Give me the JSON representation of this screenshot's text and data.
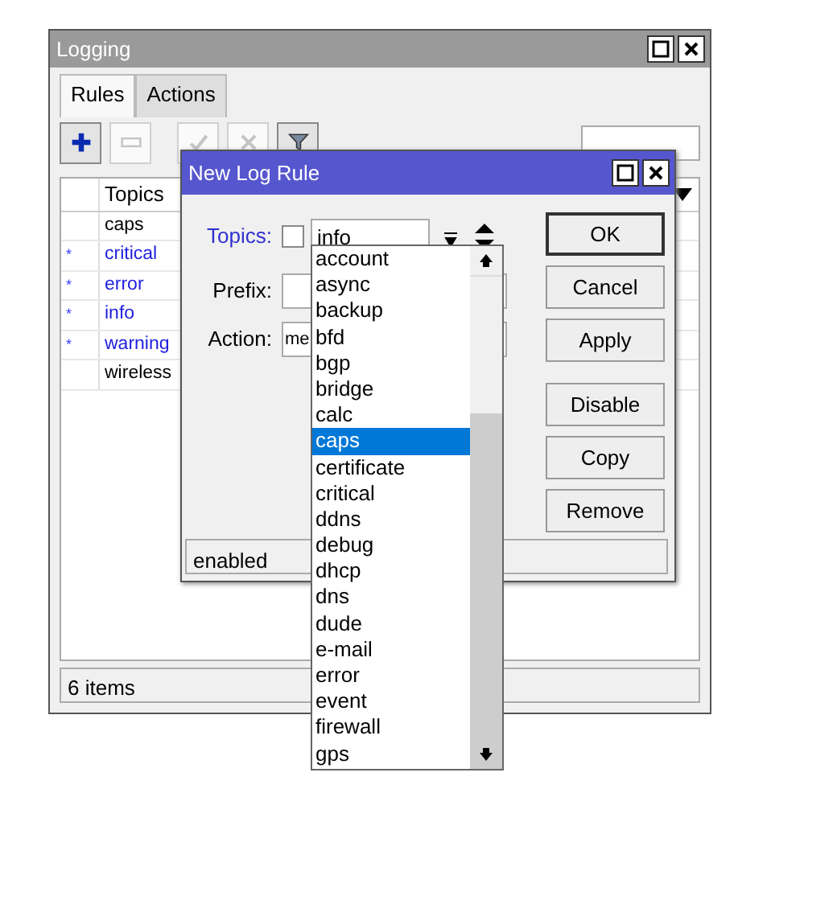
{
  "logging_window": {
    "title": "Logging",
    "tabs": [
      {
        "label": "Rules",
        "selected": true
      },
      {
        "label": "Actions",
        "selected": false
      }
    ],
    "toolbar": [
      {
        "kind": "add",
        "disabled": false
      },
      {
        "kind": "remove",
        "disabled": true
      },
      {
        "kind": "enable",
        "disabled": true
      },
      {
        "kind": "disable",
        "disabled": true
      },
      {
        "kind": "filter",
        "disabled": false
      }
    ],
    "table": {
      "columns": [
        "Topics"
      ],
      "rows": [
        {
          "topics": "caps",
          "default": false
        },
        {
          "column_1": "*",
          "topics": "critical",
          "default": true
        },
        {
          "column_1": "*",
          "topics": "error",
          "default": true
        },
        {
          "column_1": "*",
          "topics": "info",
          "default": true
        },
        {
          "column_1": "*",
          "topics": "warning",
          "default": true
        },
        {
          "topics": "wireless",
          "default": false
        }
      ]
    },
    "status_bar": "6 items"
  },
  "dialog": {
    "title": "New Log Rule",
    "topics": {
      "label": "Topics:",
      "checked": false,
      "value": "info"
    },
    "prefix": {
      "label": "Prefix:"
    },
    "action": {
      "label": "Action:",
      "value": "me"
    },
    "buttons": [
      {
        "label": "OK",
        "default": true
      },
      {
        "label": "Cancel",
        "default": false
      },
      {
        "label": "Apply",
        "default": false
      },
      {
        "label": "Disable",
        "default": false
      },
      {
        "label": "Copy",
        "default": false
      },
      {
        "label": "Remove",
        "default": false
      }
    ],
    "status": "enabled"
  },
  "topics_dropdown": {
    "items": [
      {
        "label": "account",
        "selected": false
      },
      {
        "label": "async",
        "selected": false
      },
      {
        "label": "backup",
        "selected": false
      },
      {
        "label": "bfd",
        "selected": false
      },
      {
        "label": "bgp",
        "selected": false
      },
      {
        "label": "bridge",
        "selected": false
      },
      {
        "label": "calc",
        "selected": false
      },
      {
        "label": "caps",
        "selected": true
      },
      {
        "label": "certificate",
        "selected": false
      },
      {
        "label": "critical",
        "selected": false
      },
      {
        "label": "ddns",
        "selected": false
      },
      {
        "label": "debug",
        "selected": false
      },
      {
        "label": "dhcp",
        "selected": false
      },
      {
        "label": "dns",
        "selected": false
      },
      {
        "label": "dude",
        "selected": false
      },
      {
        "label": "e-mail",
        "selected": false
      },
      {
        "label": "error",
        "selected": false
      },
      {
        "label": "event",
        "selected": false
      },
      {
        "label": "firewall",
        "selected": false
      },
      {
        "label": "gps",
        "selected": false
      }
    ]
  }
}
